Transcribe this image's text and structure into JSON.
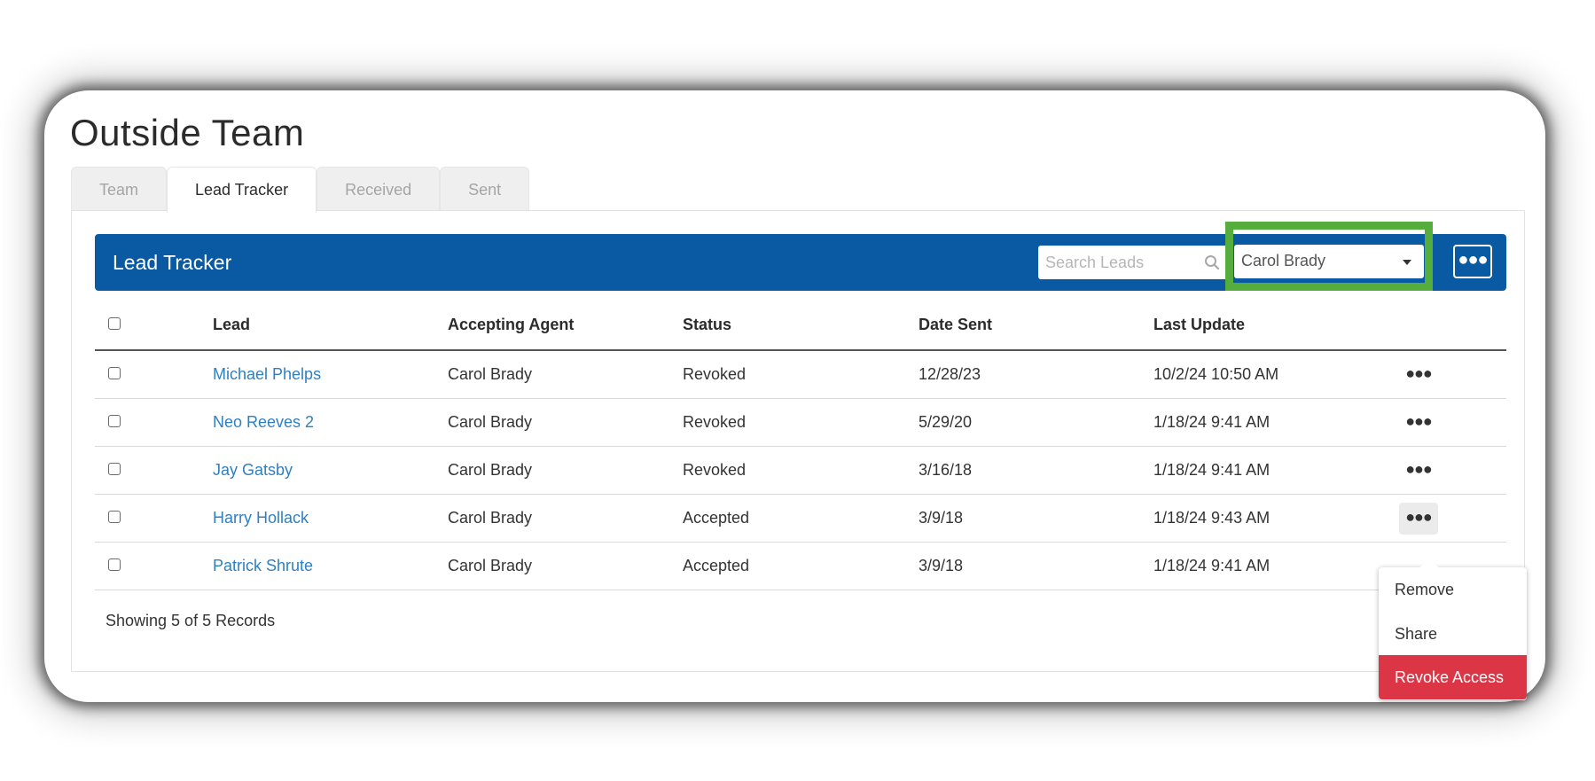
{
  "page": {
    "title": "Outside Team"
  },
  "tabs": [
    {
      "label": "Team",
      "active": false
    },
    {
      "label": "Lead Tracker",
      "active": true
    },
    {
      "label": "Received",
      "active": false
    },
    {
      "label": "Sent",
      "active": false
    }
  ],
  "toolbar": {
    "title": "Lead Tracker",
    "search_placeholder": "Search Leads",
    "agent_selected": "Carol Brady",
    "more_icon": "ellipsis-icon"
  },
  "table": {
    "columns": [
      "Lead",
      "Accepting Agent",
      "Status",
      "Date Sent",
      "Last Update"
    ],
    "rows": [
      {
        "lead": "Michael Phelps",
        "agent": "Carol Brady",
        "status": "Revoked",
        "date_sent": "12/28/23",
        "last_update": "10/2/24 10:50 AM"
      },
      {
        "lead": "Neo Reeves 2",
        "agent": "Carol Brady",
        "status": "Revoked",
        "date_sent": "5/29/20",
        "last_update": "1/18/24 9:41 AM"
      },
      {
        "lead": "Jay Gatsby",
        "agent": "Carol Brady",
        "status": "Revoked",
        "date_sent": "3/16/18",
        "last_update": "1/18/24 9:41 AM"
      },
      {
        "lead": "Harry Hollack",
        "agent": "Carol Brady",
        "status": "Accepted",
        "date_sent": "3/9/18",
        "last_update": "1/18/24 9:43 AM"
      },
      {
        "lead": "Patrick Shrute",
        "agent": "Carol Brady",
        "status": "Accepted",
        "date_sent": "3/9/18",
        "last_update": "1/18/24 9:41 AM"
      }
    ]
  },
  "footer": {
    "count_text": "Showing 5 of 5 Records"
  },
  "context_menu": {
    "items": [
      "Remove",
      "Share",
      "Revoke Access"
    ]
  },
  "colors": {
    "header_bar": "#0a5aa3",
    "link": "#2f7fc1",
    "highlight": "#54ad3c",
    "danger": "#dc3545"
  }
}
